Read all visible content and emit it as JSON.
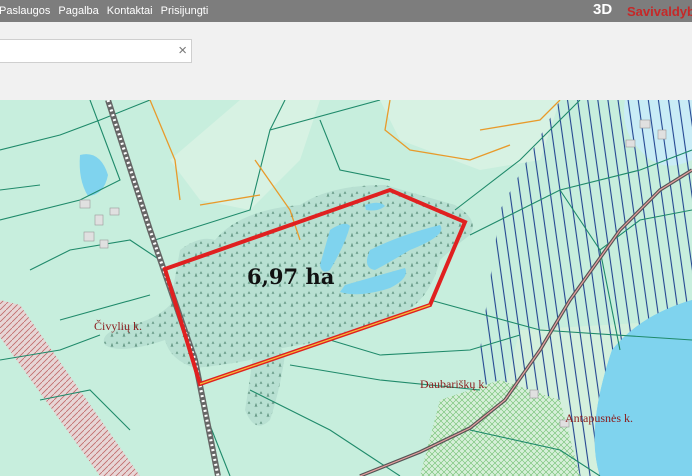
{
  "nav": {
    "items": [
      "Paslaugos",
      "Pagalba",
      "Kontaktai",
      "Prisijungti"
    ],
    "btn_3d": "3D",
    "brand": "Savivaldyb"
  },
  "search": {
    "value": "",
    "placeholder": "",
    "clear_icon": "×"
  },
  "map": {
    "area_label": "6,97 ha",
    "places": [
      "Čivylių k.",
      "Daubariškų k.",
      "Antapusnės k."
    ],
    "colors": {
      "parcel_outline": "#e02020",
      "water": "#7fd3ee",
      "background": "#c7eedd",
      "hatch": "#1a3d8c",
      "boundary": "#1f8a6a",
      "orange_line": "#e89a2a"
    }
  }
}
